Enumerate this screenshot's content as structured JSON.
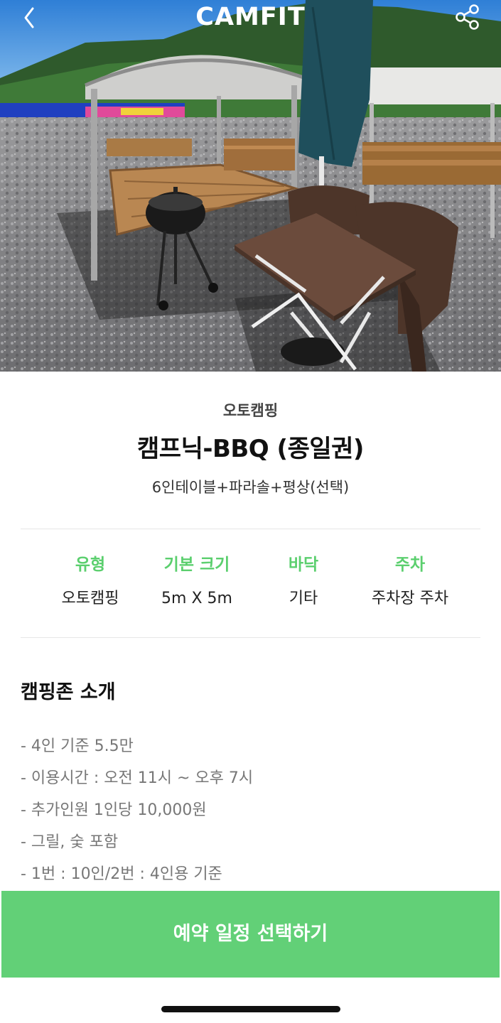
{
  "header": {
    "logo": "CAMFIT",
    "back_icon": "chevron-left-icon",
    "share_icon": "share-icon"
  },
  "hero": {
    "image": "photo of picnic gazebos with wooden decks, BBQ grill, brown table, chairs and folded parasol on gravel ground"
  },
  "site": {
    "category": "오토캠핑",
    "title": "캠프닉-BBQ (종일권)",
    "subtitle": "6인테이블+파라솔+평상(선택)"
  },
  "specs": [
    {
      "label": "유형",
      "value": "오토캠핑"
    },
    {
      "label": "기본 크기",
      "value": "5m X 5m"
    },
    {
      "label": "바닥",
      "value": "기타"
    },
    {
      "label": "주차",
      "value": "주차장 주차"
    }
  ],
  "intro": {
    "title": "캠핑존 소개",
    "lines": [
      "- 4인 기준 5.5만",
      "- 이용시간 : 오전 11시 ~ 오후 7시",
      "- 추가인원 1인당 10,000원",
      "- 그릴, 숯 포함",
      "- 1번 : 10인/2번 : 4인용 기준"
    ]
  },
  "cta": {
    "label": "예약 일정 선택하기"
  },
  "colors": {
    "accent": "#62d077",
    "spec_label": "#5bcf6e"
  }
}
